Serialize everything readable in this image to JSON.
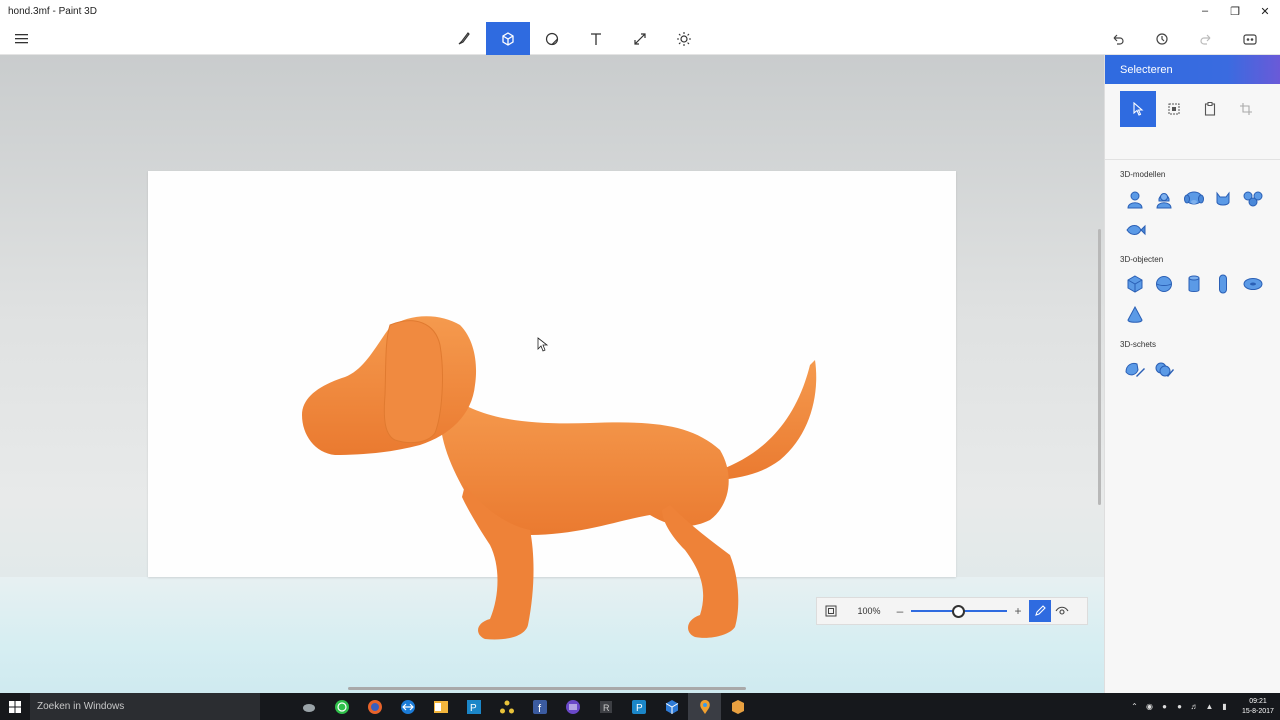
{
  "window": {
    "title": "hond.3mf - Paint 3D"
  },
  "titlebar_controls": [
    "minimize-icon",
    "restore-icon",
    "close-icon"
  ],
  "toolbar": {
    "tools": [
      {
        "name": "brushes",
        "icon": "brush-icon",
        "active": false
      },
      {
        "name": "3d-shapes",
        "icon": "cube-icon",
        "active": true
      },
      {
        "name": "stickers",
        "icon": "sticker-icon",
        "active": false
      },
      {
        "name": "text",
        "icon": "text-icon",
        "active": false
      },
      {
        "name": "canvas",
        "icon": "resize-icon",
        "active": false
      },
      {
        "name": "effects",
        "icon": "sun-icon",
        "active": false
      }
    ],
    "actions": [
      "undo-icon",
      "history-icon",
      "redo-icon",
      "mixed-reality-icon"
    ]
  },
  "panel": {
    "title": "Selecteren",
    "sections": [
      {
        "label": "3D-modellen",
        "items": [
          "man-model",
          "woman-model",
          "dog-model",
          "cat-model",
          "fish-model",
          "fish2-model"
        ]
      },
      {
        "label": "3D-objecten",
        "items": [
          "cube",
          "sphere",
          "cylinder",
          "capsule",
          "torus",
          "cone"
        ]
      },
      {
        "label": "3D-schets",
        "items": [
          "sketch-sharp",
          "sketch-soft"
        ]
      }
    ]
  },
  "zoom": {
    "value": "100%",
    "level": 0.5
  },
  "taskbar": {
    "search_placeholder": "Zoeken in Windows",
    "time": "09:21",
    "date": "15-8-2017"
  },
  "colors": {
    "accent": "#2f6be0",
    "dog": "#f28a3e",
    "icon_blue": "#4a8fe0"
  }
}
